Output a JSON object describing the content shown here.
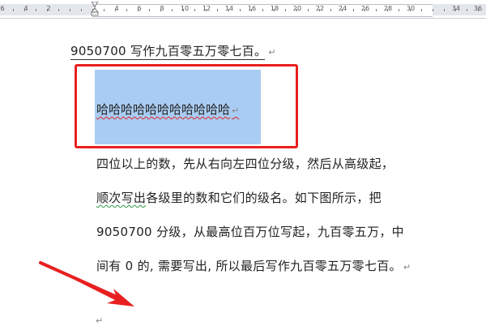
{
  "ruler": {
    "numbers": [
      "6",
      "4",
      "2",
      "2",
      "4",
      "6",
      "8",
      "10",
      "12",
      "14",
      "16",
      "18",
      "20",
      "22",
      "24",
      "26",
      "28",
      "30",
      "34",
      "36"
    ]
  },
  "document": {
    "title_line": "9050700 写作九百零五万零七百。",
    "paragraph_mark": "↵",
    "selected_text": "哈哈哈哈哈哈哈哈哈哈哈",
    "body_lines": [
      "四位以上的数，先从右向左四位分级，然后从高级起，",
      "顺次写出各级里的数和它们的级名。如下图所示，把",
      "9050700 分级，从最高位百万位写起，九百零五万，中",
      "间有 0 的, 需要写出, 所以最后写作九百零五万零七百。"
    ],
    "green_underline_word": "顺次写出"
  },
  "colors": {
    "selection": "#a9ccf2",
    "highlight_box": "#e8201f",
    "annotation_arrow": "#e8201f",
    "spell_underline": "#e0262a",
    "grammar_underline": "#2b9a3c"
  }
}
